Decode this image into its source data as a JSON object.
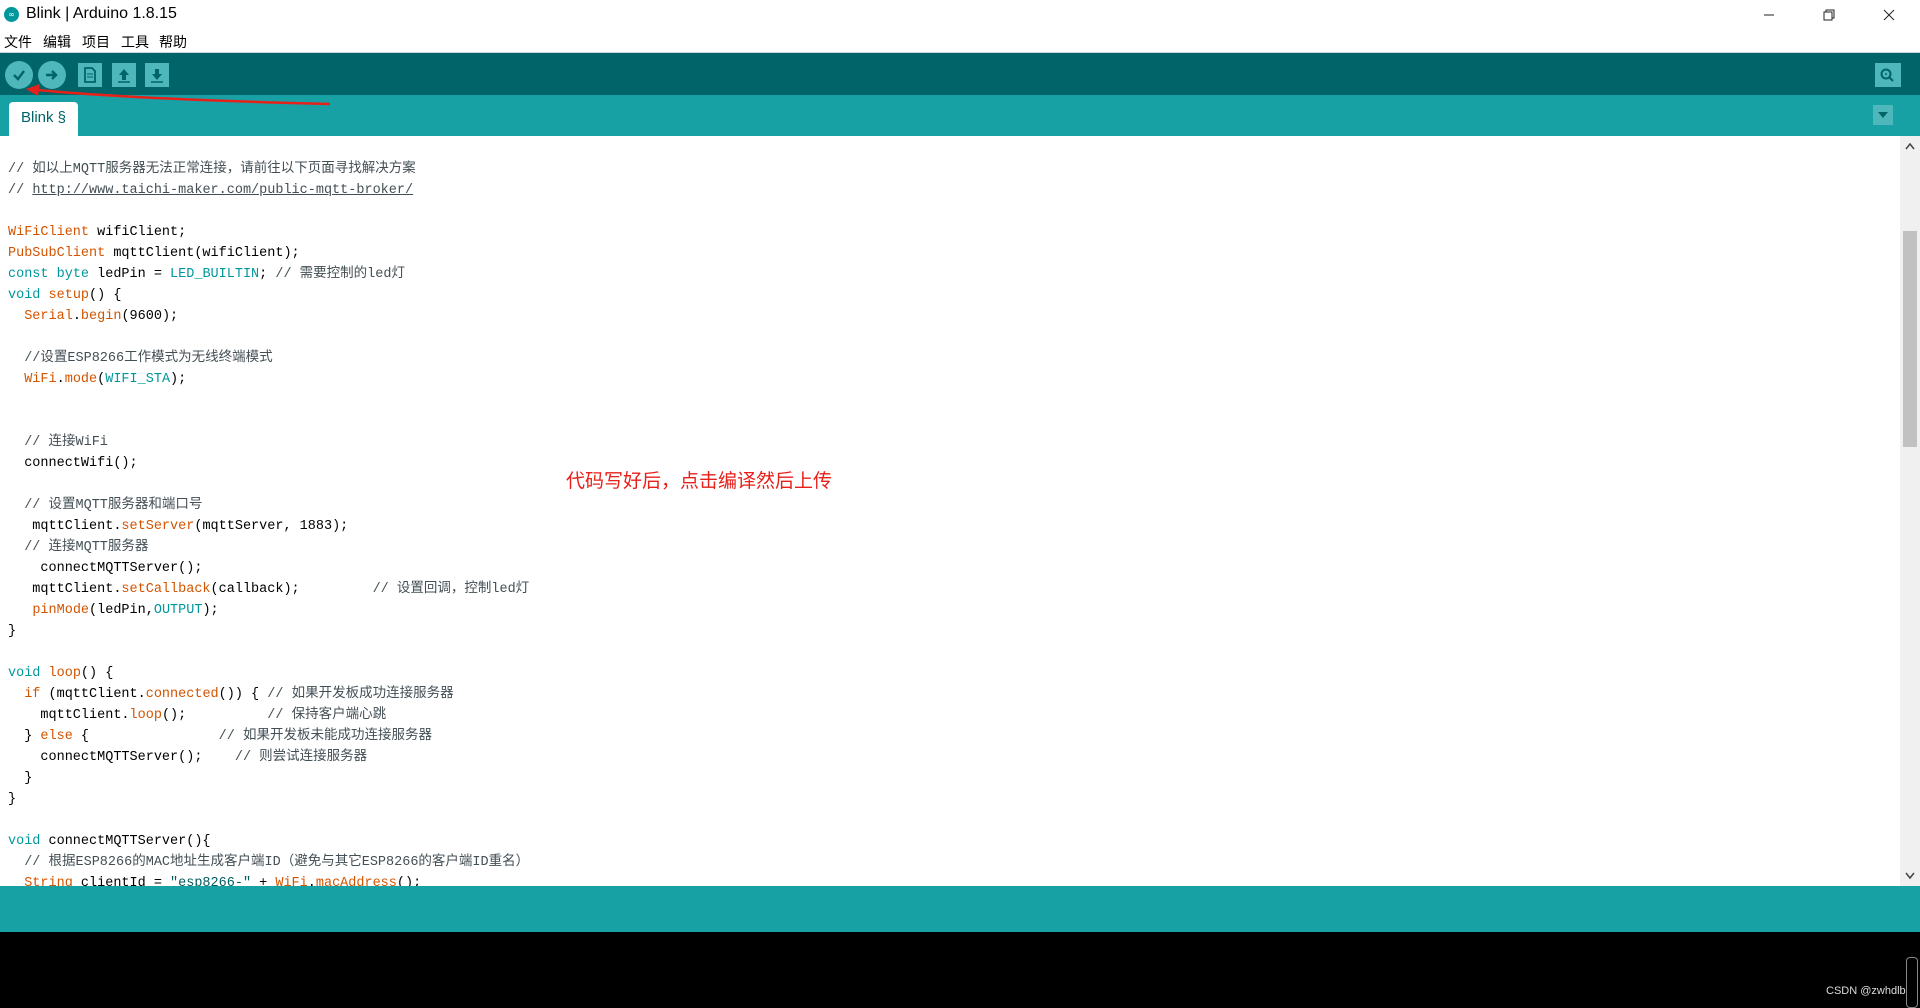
{
  "window": {
    "title": "Blink | Arduino 1.8.15",
    "logo_icon": "arduino-logo-icon",
    "controls": [
      "minimize-icon",
      "maximize-icon",
      "close-icon"
    ]
  },
  "menu": {
    "file": "文件",
    "edit": "编辑",
    "sketch": "项目",
    "tools": "工具",
    "help": "帮助"
  },
  "toolbar": {
    "verify_icon": "checkmark-icon",
    "upload_icon": "arrow-right-icon",
    "new_icon": "new-file-icon",
    "open_icon": "arrow-up-icon",
    "save_icon": "arrow-down-icon",
    "serial_monitor_icon": "magnifier-icon"
  },
  "tabs": [
    {
      "label": "Blink §",
      "active": true
    }
  ],
  "editor": {
    "annotation": "代码写好后，点击编译然后上传",
    "lines": {
      "l1": "// 如以上MQTT服务器无法正常连接，请前往以下页面寻找解决方案",
      "l2_prefix": "// ",
      "l2_url": "http://www.taichi-maker.com/public-mqtt-broker/",
      "l4a": "WiFiClient",
      "l4b": " wifiClient;",
      "l5a": "PubSubClient",
      "l5b": " mqttClient(wifiClient);",
      "l6a": "const",
      "l6b": " ",
      "l6c": "byte",
      "l6d": " ledPin = ",
      "l6e": "LED_BUILTIN",
      "l6f": "; ",
      "l6g": "// 需要控制的led灯",
      "l7a": "void",
      "l7b": " ",
      "l7c": "setup",
      "l7d": "() {",
      "l8a": "  ",
      "l8b": "Serial",
      "l8c": ".",
      "l8d": "begin",
      "l8e": "(9600);",
      "l10": "  //设置ESP8266工作模式为无线终端模式",
      "l11a": "  ",
      "l11b": "WiFi",
      "l11c": ".",
      "l11d": "mode",
      "l11e": "(",
      "l11f": "WIFI_STA",
      "l11g": ");",
      "l14": "  // 连接WiFi",
      "l15": "  connectWifi();",
      "l17": "  // 设置MQTT服务器和端口号",
      "l18a": "   mqttClient.",
      "l18b": "setServer",
      "l18c": "(mqttServer, 1883);",
      "l19": "  // 连接MQTT服务器",
      "l20": "    connectMQTTServer();",
      "l21a": "   mqttClient.",
      "l21b": "setCallback",
      "l21c": "(callback);         ",
      "l21d": "// 设置回调，控制led灯",
      "l22a": "   ",
      "l22b": "pinMode",
      "l22c": "(ledPin,",
      "l22d": "OUTPUT",
      "l22e": ");",
      "l23": "}",
      "l25a": "void",
      "l25b": " ",
      "l25c": "loop",
      "l25d": "() {",
      "l26a": "  ",
      "l26b": "if",
      "l26c": " (mqttClient.",
      "l26d": "connected",
      "l26e": "()) { ",
      "l26f": "// 如果开发板成功连接服务器",
      "l27a": "    mqttClient.",
      "l27b": "loop",
      "l27c": "();          ",
      "l27d": "// 保持客户端心跳",
      "l28a": "  } ",
      "l28b": "else",
      "l28c": " {                ",
      "l28d": "// 如果开发板未能成功连接服务器",
      "l29a": "    connectMQTTServer();    ",
      "l29b": "// 则尝试连接服务器",
      "l30": "  }",
      "l31": "}",
      "l33a": "void",
      "l33b": " connectMQTTServer(){",
      "l34": "  // 根据ESP8266的MAC地址生成客户端ID（避免与其它ESP8266的客户端ID重名）",
      "l35a": "  ",
      "l35b": "String",
      "l35c": " clientId = ",
      "l35d": "\"esp8266-\"",
      "l35e": " + ",
      "l35f": "WiFi",
      "l35g": ".",
      "l35h": "macAddress",
      "l35i": "();"
    }
  },
  "footer": {
    "watermark": "CSDN @zwhdlb"
  },
  "colors": {
    "toolbar_bg": "#006468",
    "tabbar_bg": "#17a1a5",
    "button_bg": "#4db7bb",
    "keyword_type": "#00979c",
    "keyword_lib": "#d35400",
    "annotation": "#e8201a",
    "arrow": "#e8201a"
  }
}
